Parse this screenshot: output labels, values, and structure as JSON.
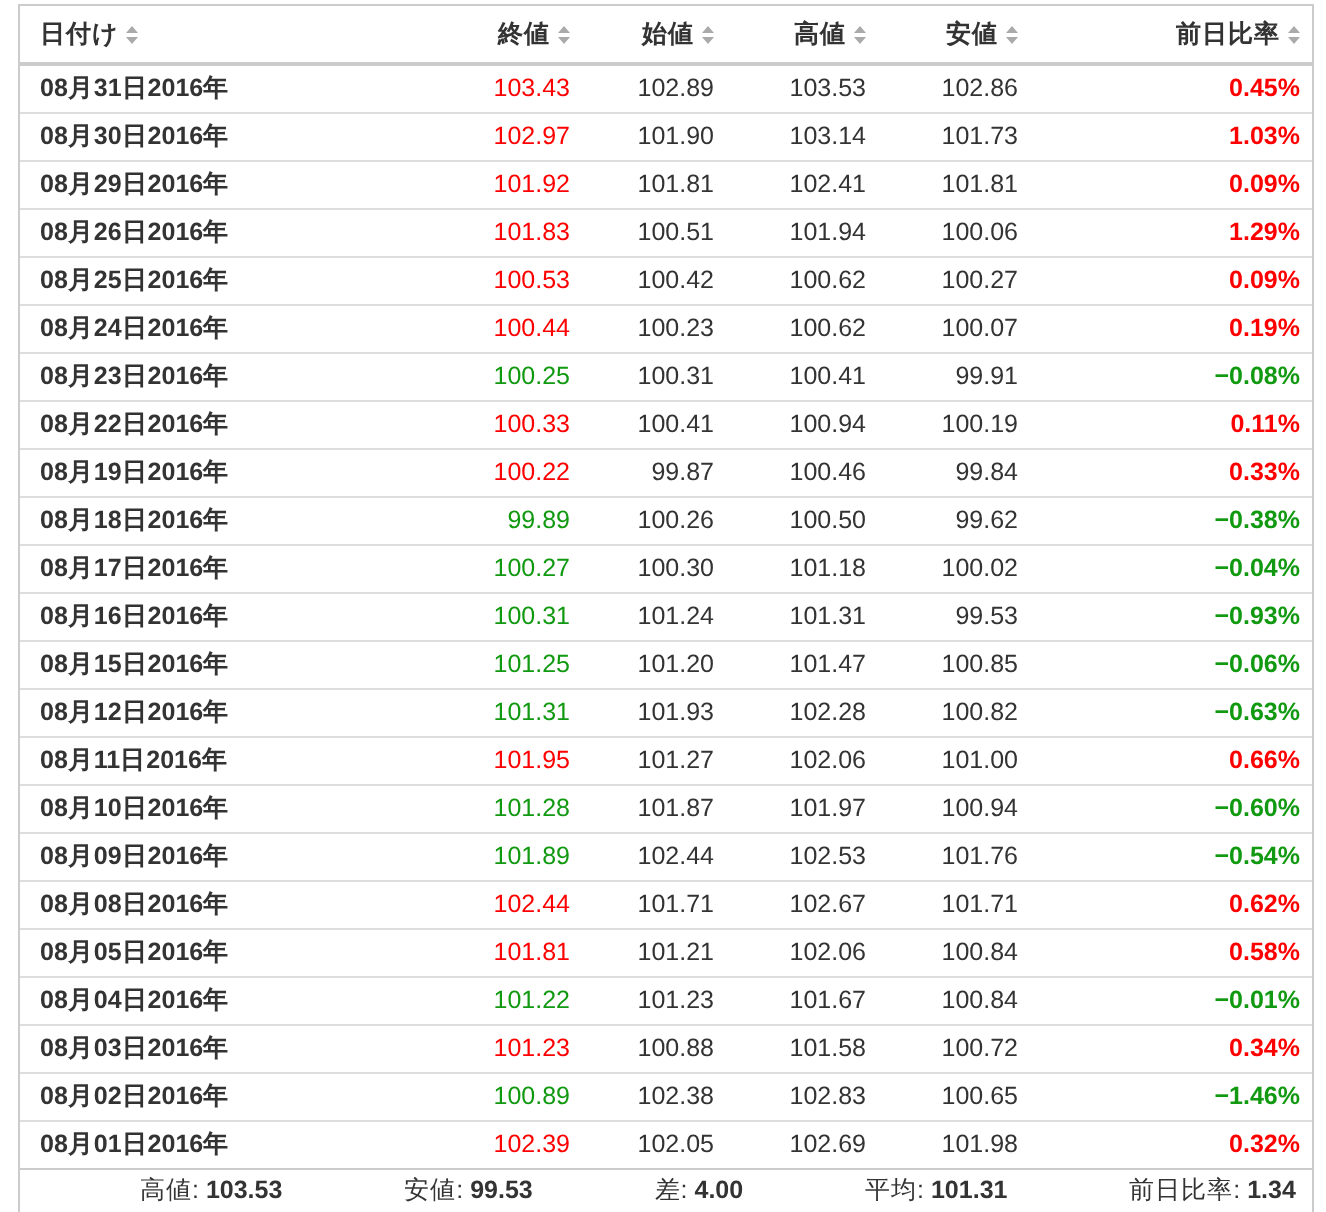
{
  "table": {
    "columns": [
      "日付け",
      "終値",
      "始値",
      "高値",
      "安値",
      "前日比率"
    ],
    "rows": [
      {
        "date": "08月31日2016年",
        "close": "103.43",
        "open": "102.89",
        "high": "103.53",
        "low": "102.86",
        "change": "0.45%",
        "kind": "up"
      },
      {
        "date": "08月30日2016年",
        "close": "102.97",
        "open": "101.90",
        "high": "103.14",
        "low": "101.73",
        "change": "1.03%",
        "kind": "up"
      },
      {
        "date": "08月29日2016年",
        "close": "101.92",
        "open": "101.81",
        "high": "102.41",
        "low": "101.81",
        "change": "0.09%",
        "kind": "up"
      },
      {
        "date": "08月26日2016年",
        "close": "101.83",
        "open": "100.51",
        "high": "101.94",
        "low": "100.06",
        "change": "1.29%",
        "kind": "up"
      },
      {
        "date": "08月25日2016年",
        "close": "100.53",
        "open": "100.42",
        "high": "100.62",
        "low": "100.27",
        "change": "0.09%",
        "kind": "up"
      },
      {
        "date": "08月24日2016年",
        "close": "100.44",
        "open": "100.23",
        "high": "100.62",
        "low": "100.07",
        "change": "0.19%",
        "kind": "up"
      },
      {
        "date": "08月23日2016年",
        "close": "100.25",
        "open": "100.31",
        "high": "100.41",
        "low": "99.91",
        "change": "−0.08%",
        "kind": "down"
      },
      {
        "date": "08月22日2016年",
        "close": "100.33",
        "open": "100.41",
        "high": "100.94",
        "low": "100.19",
        "change": "0.11%",
        "kind": "up"
      },
      {
        "date": "08月19日2016年",
        "close": "100.22",
        "open": "99.87",
        "high": "100.46",
        "low": "99.84",
        "change": "0.33%",
        "kind": "up"
      },
      {
        "date": "08月18日2016年",
        "close": "99.89",
        "open": "100.26",
        "high": "100.50",
        "low": "99.62",
        "change": "−0.38%",
        "kind": "down"
      },
      {
        "date": "08月17日2016年",
        "close": "100.27",
        "open": "100.30",
        "high": "101.18",
        "low": "100.02",
        "change": "−0.04%",
        "kind": "down"
      },
      {
        "date": "08月16日2016年",
        "close": "100.31",
        "open": "101.24",
        "high": "101.31",
        "low": "99.53",
        "change": "−0.93%",
        "kind": "down"
      },
      {
        "date": "08月15日2016年",
        "close": "101.25",
        "open": "101.20",
        "high": "101.47",
        "low": "100.85",
        "change": "−0.06%",
        "kind": "down"
      },
      {
        "date": "08月12日2016年",
        "close": "101.31",
        "open": "101.93",
        "high": "102.28",
        "low": "100.82",
        "change": "−0.63%",
        "kind": "down"
      },
      {
        "date": "08月11日2016年",
        "close": "101.95",
        "open": "101.27",
        "high": "102.06",
        "low": "101.00",
        "change": "0.66%",
        "kind": "up"
      },
      {
        "date": "08月10日2016年",
        "close": "101.28",
        "open": "101.87",
        "high": "101.97",
        "low": "100.94",
        "change": "−0.60%",
        "kind": "down"
      },
      {
        "date": "08月09日2016年",
        "close": "101.89",
        "open": "102.44",
        "high": "102.53",
        "low": "101.76",
        "change": "−0.54%",
        "kind": "down"
      },
      {
        "date": "08月08日2016年",
        "close": "102.44",
        "open": "101.71",
        "high": "102.67",
        "low": "101.71",
        "change": "0.62%",
        "kind": "up"
      },
      {
        "date": "08月05日2016年",
        "close": "101.81",
        "open": "101.21",
        "high": "102.06",
        "low": "100.84",
        "change": "0.58%",
        "kind": "up"
      },
      {
        "date": "08月04日2016年",
        "close": "101.22",
        "open": "101.23",
        "high": "101.67",
        "low": "100.84",
        "change": "−0.01%",
        "kind": "down"
      },
      {
        "date": "08月03日2016年",
        "close": "101.23",
        "open": "100.88",
        "high": "101.58",
        "low": "100.72",
        "change": "0.34%",
        "kind": "up"
      },
      {
        "date": "08月02日2016年",
        "close": "100.89",
        "open": "102.38",
        "high": "102.83",
        "low": "100.65",
        "change": "−1.46%",
        "kind": "down"
      },
      {
        "date": "08月01日2016年",
        "close": "102.39",
        "open": "102.05",
        "high": "102.69",
        "low": "101.98",
        "change": "0.32%",
        "kind": "up"
      }
    ]
  },
  "summary": [
    "高値: **103.53**",
    "安値: **99.53**",
    "差: **4.00**",
    "平均: **101.31**",
    "前日比率: **1.34**"
  ]
}
